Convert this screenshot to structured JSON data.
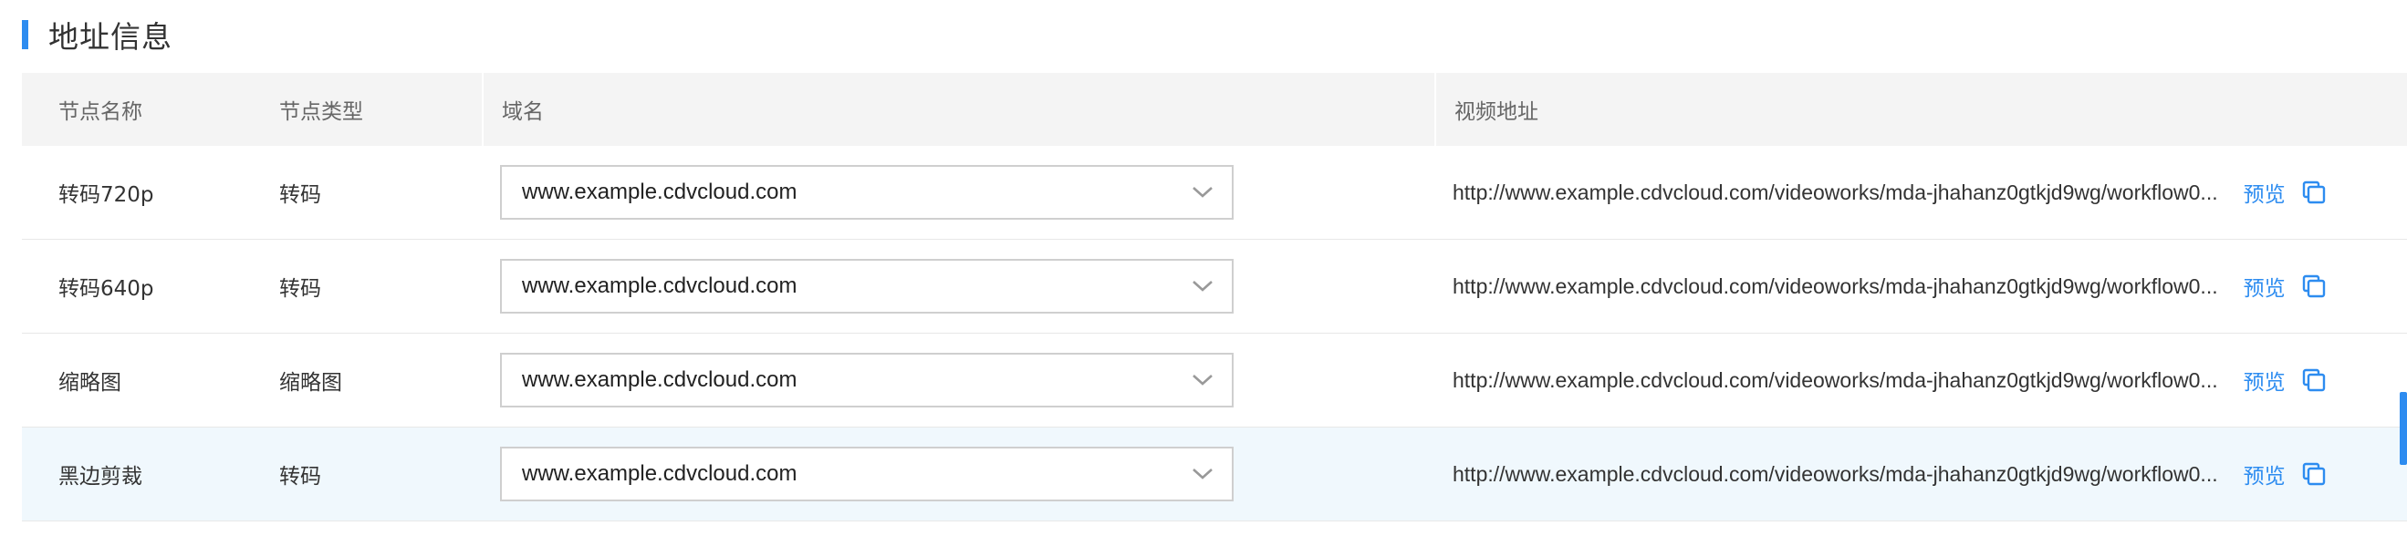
{
  "section": {
    "title": "地址信息",
    "accent_color": "#2d8cf0"
  },
  "table": {
    "headers": [
      "节点名称",
      "节点类型",
      "域名",
      "视频地址"
    ],
    "rows": [
      {
        "name": "转码720p",
        "type": "转码",
        "domain": "www.example.cdvcloud.com",
        "url": "http://www.example.cdvcloud.com/videoworks/mda-jhahanz0gtkjd9wg/workflow0...",
        "preview_label": "预览"
      },
      {
        "name": "转码640p",
        "type": "转码",
        "domain": "www.example.cdvcloud.com",
        "url": "http://www.example.cdvcloud.com/videoworks/mda-jhahanz0gtkjd9wg/workflow0...",
        "preview_label": "预览"
      },
      {
        "name": "缩略图",
        "type": "缩略图",
        "domain": "www.example.cdvcloud.com",
        "url": "http://www.example.cdvcloud.com/videoworks/mda-jhahanz0gtkjd9wg/workflow0...",
        "preview_label": "预览"
      },
      {
        "name": "黑边剪裁",
        "type": "转码",
        "domain": "www.example.cdvcloud.com",
        "url": "http://www.example.cdvcloud.com/videoworks/mda-jhahanz0gtkjd9wg/workflow0...",
        "preview_label": "预览"
      }
    ]
  },
  "icons": {
    "select_arrow": "chevron-down-icon",
    "copy": "copy-icon"
  },
  "colors": {
    "link": "#2d8cf0",
    "header_bg": "#f4f4f4",
    "highlight_row_bg": "#f0f8fd"
  }
}
